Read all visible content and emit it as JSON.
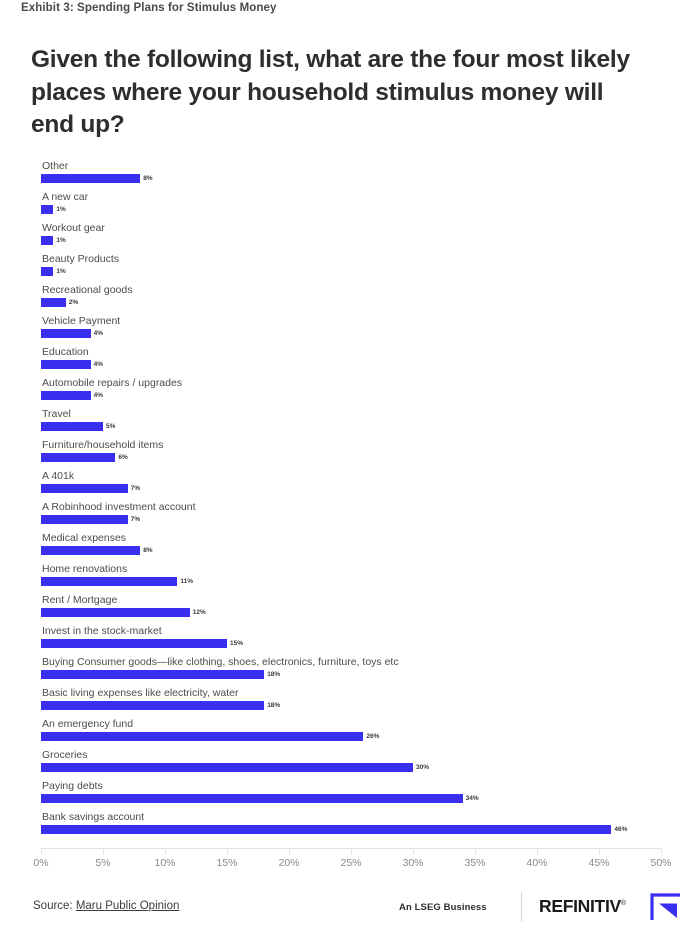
{
  "exhibit": {
    "caption": "Exhibit 3: Spending Plans for Stimulus Money"
  },
  "title": {
    "text": "Given the following list, what are the four most likely places where your household stimulus money will end up?"
  },
  "footer": {
    "source_prefix": "Source: ",
    "source_link": "Maru Public Opinion",
    "lseg": "An LSEG Business",
    "brand": "REFINITIV",
    "brand_reg": "®",
    "brand_icon": "refinitiv-arrow-logo"
  },
  "colors": {
    "bar": "#3a2ff0",
    "axis": "#e2e2e2",
    "tick_label": "#8a8a8a",
    "label": "#4c4c4c"
  },
  "chart_data": {
    "type": "bar",
    "orientation": "horizontal",
    "title": "Given the following list, what are the four most likely places where your household stimulus money will end up?",
    "xlabel": "",
    "ylabel": "",
    "xlim": [
      0,
      50
    ],
    "grid": false,
    "legend": "none",
    "value_suffix": "%",
    "xticks": [
      "0%",
      "5%",
      "10%",
      "15%",
      "20%",
      "25%",
      "30%",
      "35%",
      "40%",
      "45%",
      "50%"
    ],
    "xtick_values": [
      0,
      5,
      10,
      15,
      20,
      25,
      30,
      35,
      40,
      45,
      50
    ],
    "categories": [
      "Other",
      "A new car",
      "Workout gear",
      "Beauty Products",
      "Recreational goods",
      "Vehicle Payment",
      "Education",
      "Automobile repairs / upgrades",
      "Travel",
      "Furniture/household items",
      "A 401k",
      "A Robinhood investment account",
      "Medical expenses",
      "Home renovations",
      "Rent / Mortgage",
      "Invest in the stock-market",
      "Buying Consumer goods—like clothing, shoes, electronics, furniture, toys etc",
      "Basic living expenses like electricity, water",
      "An emergency fund",
      "Groceries",
      "Paying debts",
      "Bank savings account"
    ],
    "values": [
      8,
      1,
      1,
      1,
      2,
      4,
      4,
      4,
      5,
      6,
      7,
      7,
      8,
      11,
      12,
      15,
      18,
      18,
      26,
      30,
      34,
      46
    ],
    "value_labels": [
      "8%",
      "1%",
      "1%",
      "1%",
      "2%",
      "4%",
      "4%",
      "4%",
      "5%",
      "6%",
      "7%",
      "7%",
      "8%",
      "11%",
      "12%",
      "15%",
      "18%",
      "18%",
      "26%",
      "30%",
      "34%",
      "46%"
    ]
  }
}
